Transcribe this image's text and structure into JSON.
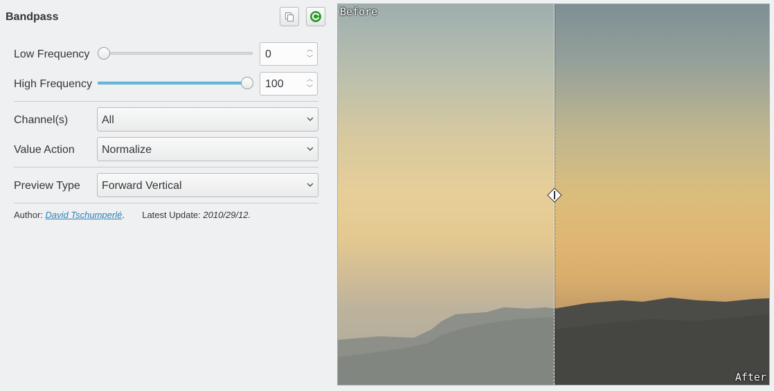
{
  "filter": {
    "title": "Bandpass"
  },
  "toolbar": {
    "copy_icon": "copy-icon",
    "refresh_icon": "refresh-icon",
    "refresh_color": "#2e9b2e"
  },
  "params": {
    "low_frequency": {
      "label": "Low Frequency",
      "value": "0",
      "slider_fraction": 0.0
    },
    "high_frequency": {
      "label": "High Frequency",
      "value": "100",
      "slider_fraction": 1.0
    },
    "channels": {
      "label": "Channel(s)",
      "value": "All"
    },
    "value_action": {
      "label": "Value Action",
      "value": "Normalize"
    },
    "preview_type": {
      "label": "Preview Type",
      "value": "Forward Vertical"
    }
  },
  "meta": {
    "author_label": "Author:",
    "author_name": "David Tschumperlé",
    "author_suffix": ".",
    "update_label": "Latest Update:",
    "update_value": "2010/29/12."
  },
  "preview": {
    "before_label": "Before",
    "after_label": "After",
    "split_fraction": 0.5
  },
  "colors": {
    "accent": "#6fc0e6",
    "link": "#2980b9",
    "panel_bg": "#eff0f1"
  }
}
